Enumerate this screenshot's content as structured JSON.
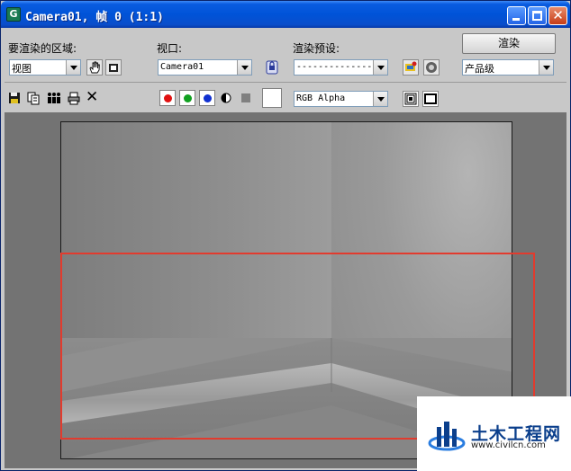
{
  "window": {
    "title": "Camera01, 帧 0 (1:1)",
    "app_icon_glyph": "G",
    "title_bar_color": "#0053d8",
    "icons": {
      "minimize": "minimize-icon",
      "maximize": "maximize-icon",
      "close": "close-icon"
    },
    "close_glyph": "✕"
  },
  "render_area": {
    "label": "要渲染的区域:",
    "value": "视图",
    "icons": [
      "pan-hand-icon",
      "region-select-icon"
    ]
  },
  "viewport": {
    "label": "视口:",
    "value": "Camera01",
    "icons": [
      "lock-viewport-icon"
    ]
  },
  "render_preset": {
    "label": "渲染预设:",
    "value": "--------------",
    "icons": [
      "render-setup-icon",
      "environment-effects-icon"
    ]
  },
  "render_button": {
    "label": "渲染"
  },
  "quality": {
    "value": "产品级"
  },
  "toolbar": {
    "icons": [
      "save-image-icon",
      "copy-image-icon",
      "clone-window-icon",
      "print-image-icon",
      "clear-icon"
    ],
    "clear_glyph": "✕"
  },
  "channels": {
    "red": {
      "color": "#e01010",
      "icon": "red-channel-icon"
    },
    "green": {
      "color": "#10a020",
      "icon": "green-channel-icon"
    },
    "blue": {
      "color": "#1030d0",
      "icon": "blue-channel-icon"
    },
    "alpha_icon": "alpha-channel-icon",
    "mono_icon": "monochrome-icon",
    "swatch_color": "#ffffff"
  },
  "channel_display": {
    "value": "RGB Alpha"
  },
  "display_icons": [
    "toggle-ui-overlay-icon",
    "toggle-ui-icon"
  ],
  "highlight_color": "#e23b2e",
  "watermark": {
    "title": "土木工程网",
    "url": "www.civilcn.com"
  }
}
